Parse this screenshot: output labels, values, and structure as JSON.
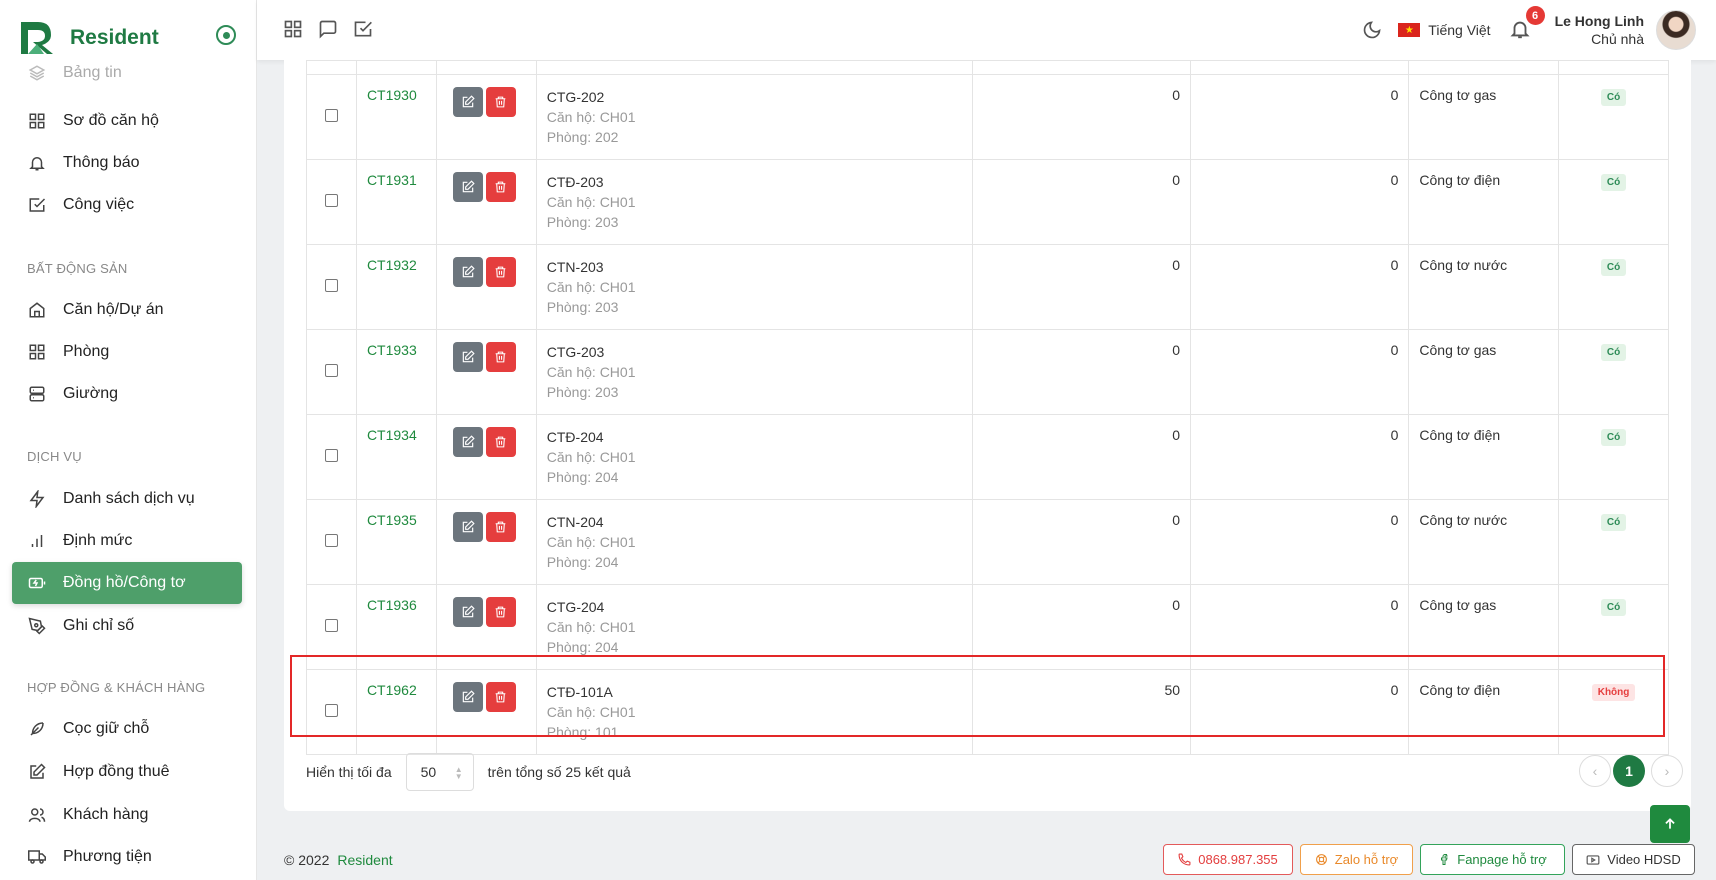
{
  "brand": {
    "name": "Resident",
    "accent": "#1f7a43"
  },
  "sidebar": {
    "items_top": [
      {
        "label": "Bảng tin",
        "icon": "layers-icon",
        "faded": true
      },
      {
        "label": "Sơ đồ căn hộ",
        "icon": "grid-icon"
      },
      {
        "label": "Thông báo",
        "icon": "bell-icon"
      },
      {
        "label": "Công việc",
        "icon": "checkbox-icon"
      }
    ],
    "section_realestate": "BẤT ĐỘNG SẢN",
    "items_realestate": [
      {
        "label": "Căn hộ/Dự án",
        "icon": "home-icon"
      },
      {
        "label": "Phòng",
        "icon": "grid-icon"
      },
      {
        "label": "Giường",
        "icon": "server-icon"
      }
    ],
    "section_service": "DỊCH VỤ",
    "items_service": [
      {
        "label": "Danh sách dịch vụ",
        "icon": "bolt-icon"
      },
      {
        "label": "Định mức",
        "icon": "bar-chart-icon"
      },
      {
        "label": "Đồng hồ/Công tơ",
        "icon": "meter-icon",
        "active": true
      },
      {
        "label": "Ghi chỉ số",
        "icon": "pen-icon"
      }
    ],
    "section_contract": "HỢP ĐỒNG & KHÁCH HÀNG",
    "items_contract": [
      {
        "label": "Cọc giữ chỗ",
        "icon": "feather-icon"
      },
      {
        "label": "Hợp đồng thuê",
        "icon": "edit-icon"
      },
      {
        "label": "Khách hàng",
        "icon": "users-icon"
      },
      {
        "label": "Phương tiện",
        "icon": "truck-icon"
      }
    ]
  },
  "header": {
    "language": "Tiếng Việt",
    "notification_count": "6",
    "user_name": "Le Hong Linh",
    "user_role": "Chủ nhà"
  },
  "table": {
    "rows": [
      {
        "code": "CT1930",
        "name": "CTG-202",
        "apartment": "Căn hộ: CH01",
        "room": "Phòng: 202",
        "value1": "0",
        "value2": "0",
        "type": "Công tơ gas",
        "flag": "Có"
      },
      {
        "code": "CT1931",
        "name": "CTĐ-203",
        "apartment": "Căn hộ: CH01",
        "room": "Phòng: 203",
        "value1": "0",
        "value2": "0",
        "type": "Công tơ điện",
        "flag": "Có"
      },
      {
        "code": "CT1932",
        "name": "CTN-203",
        "apartment": "Căn hộ: CH01",
        "room": "Phòng: 203",
        "value1": "0",
        "value2": "0",
        "type": "Công tơ nước",
        "flag": "Có"
      },
      {
        "code": "CT1933",
        "name": "CTG-203",
        "apartment": "Căn hộ: CH01",
        "room": "Phòng: 203",
        "value1": "0",
        "value2": "0",
        "type": "Công tơ gas",
        "flag": "Có"
      },
      {
        "code": "CT1934",
        "name": "CTĐ-204",
        "apartment": "Căn hộ: CH01",
        "room": "Phòng: 204",
        "value1": "0",
        "value2": "0",
        "type": "Công tơ điện",
        "flag": "Có"
      },
      {
        "code": "CT1935",
        "name": "CTN-204",
        "apartment": "Căn hộ: CH01",
        "room": "Phòng: 204",
        "value1": "0",
        "value2": "0",
        "type": "Công tơ nước",
        "flag": "Có"
      },
      {
        "code": "CT1936",
        "name": "CTG-204",
        "apartment": "Căn hộ: CH01",
        "room": "Phòng: 204",
        "value1": "0",
        "value2": "0",
        "type": "Công tơ gas",
        "flag": "Có"
      },
      {
        "code": "CT1962",
        "name": "CTĐ-101A",
        "apartment": "Căn hộ: CH01",
        "room": "Phòng: 101",
        "value1": "50",
        "value2": "0",
        "type": "Công tơ điện",
        "flag": "Không"
      }
    ]
  },
  "pagination": {
    "show_label": "Hiển thị tối đa",
    "page_size": "50",
    "total_label": "trên tổng số 25 kết quả",
    "current_page": "1"
  },
  "footer": {
    "copyright": "© 2022",
    "brand": "Resident",
    "phone": "0868.987.355",
    "zalo": "Zalo hỗ trợ",
    "fanpage": "Fanpage hỗ trợ",
    "video": "Video HDSD"
  }
}
